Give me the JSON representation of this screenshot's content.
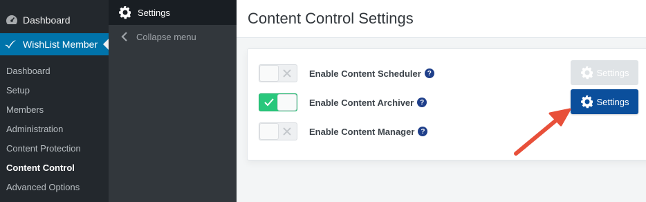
{
  "sidebar": {
    "dashboard_label": "Dashboard",
    "plugin_label": "WishList Member",
    "submenu": [
      {
        "label": "Dashboard",
        "active": false
      },
      {
        "label": "Setup",
        "active": false
      },
      {
        "label": "Members",
        "active": false
      },
      {
        "label": "Administration",
        "active": false
      },
      {
        "label": "Content Protection",
        "active": false
      },
      {
        "label": "Content Control",
        "active": true
      },
      {
        "label": "Advanced Options",
        "active": false
      }
    ]
  },
  "flyout": {
    "settings_label": "Settings",
    "collapse_label": "Collapse menu"
  },
  "page": {
    "title": "Content Control Settings"
  },
  "options": [
    {
      "label": "Enable Content Scheduler",
      "enabled": false,
      "settings_label": "Settings",
      "settings_state": "disabled"
    },
    {
      "label": "Enable Content Archiver",
      "enabled": true,
      "settings_label": "Settings",
      "settings_state": "active"
    },
    {
      "label": "Enable Content Manager",
      "enabled": false
    }
  ],
  "help_glyph": "?",
  "colors": {
    "wp_sidebar": "#23282d",
    "wp_blue": "#0073aa",
    "toggle_on": "#29c77c",
    "primary_button": "#0b4f9c",
    "help_icon": "#1f3f8a",
    "annotation_arrow": "#e8503a"
  },
  "icons": {
    "dashboard": "dashboard-icon",
    "plugin": "wishlist-check-icon",
    "settings": "gear-icon",
    "collapse": "chevron-left-icon",
    "toggle_off": "x-icon",
    "toggle_on": "check-icon"
  }
}
